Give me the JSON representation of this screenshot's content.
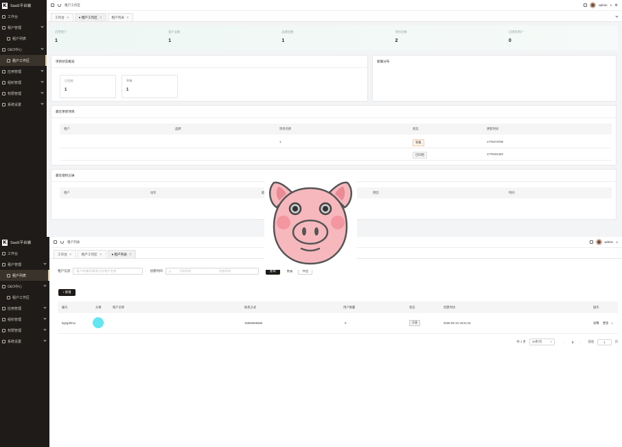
{
  "screen1": {
    "brand": "SaaS平台端",
    "nav": [
      {
        "label": "工作台",
        "icon": "desktop-icon"
      },
      {
        "label": "租户管理",
        "icon": "users-icon",
        "chevron": true
      },
      {
        "label": "租户列表",
        "icon": "user-icon",
        "sub": true
      },
      {
        "label": "GEO中心",
        "icon": "globe-icon",
        "chevron": true
      },
      {
        "label": "租户工作区",
        "icon": "monitor-icon",
        "sub": true,
        "active": true
      },
      {
        "label": "应用管理",
        "icon": "app-icon",
        "chevron": true
      },
      {
        "label": "组织管理",
        "icon": "org-icon",
        "chevron": true
      },
      {
        "label": "权限管理",
        "icon": "lock-icon",
        "chevron": true
      },
      {
        "label": "系统设置",
        "icon": "gear-icon",
        "chevron": true
      }
    ],
    "breadcrumb": "租户工作区",
    "user": "admin",
    "tabs": [
      {
        "label": "工作台",
        "active": false
      },
      {
        "label": "● 租户工作区",
        "active": true
      },
      {
        "label": "租户列表",
        "active": false
      }
    ],
    "stats": [
      {
        "label": "启用租户",
        "value": "1"
      },
      {
        "label": "客户总数",
        "value": "1"
      },
      {
        "label": "品牌总数",
        "value": "1"
      },
      {
        "label": "项目总数",
        "value": "2"
      },
      {
        "label": "已授权用户",
        "value": "0"
      }
    ],
    "project_status": {
      "title": "项目状态概览",
      "items": [
        {
          "label": "已归档",
          "value": "1"
        },
        {
          "label": "草稿",
          "value": "1"
        }
      ]
    },
    "ranking_title": "套餐分布",
    "recent": {
      "title": "最近更新项目",
      "columns": [
        "租户",
        "品牌",
        "项目名称",
        "状态",
        "更新时间"
      ],
      "rows": [
        {
          "name": "1",
          "status": "草稿",
          "time": "1779473706"
        },
        {
          "name": "",
          "status": "已归档",
          "time": "1779431402"
        }
      ]
    },
    "authz": {
      "title": "最近授权记录",
      "columns": [
        "租户",
        "动作",
        "能力值",
        "原因",
        "时间"
      ]
    }
  },
  "screen2": {
    "brand": "SaaS平台端",
    "nav": [
      {
        "label": "工作台",
        "icon": "desktop-icon"
      },
      {
        "label": "租户管理",
        "icon": "users-icon",
        "chevron": true
      },
      {
        "label": "租户列表",
        "icon": "user-icon",
        "sub": true,
        "active": true
      },
      {
        "label": "GEO中心",
        "icon": "globe-icon",
        "chevron": true
      },
      {
        "label": "租户工作区",
        "icon": "monitor-icon",
        "sub": true
      },
      {
        "label": "应用管理",
        "icon": "app-icon",
        "chevron": true
      },
      {
        "label": "组织管理",
        "icon": "org-icon",
        "chevron": true
      },
      {
        "label": "权限管理",
        "icon": "lock-icon",
        "chevron": true
      },
      {
        "label": "系统设置",
        "icon": "gear-icon",
        "chevron": true
      }
    ],
    "breadcrumb": "租户列表",
    "user": "admin",
    "tabs": [
      {
        "label": "工作台",
        "active": false
      },
      {
        "label": "租户工作区",
        "active": false
      },
      {
        "label": "● 租户列表",
        "active": true
      }
    ],
    "filter": {
      "tenant_label": "租户信息",
      "tenant_placeholder": "租户ID/编号/联系方式/租户名称",
      "created_label": "创建时间",
      "start_placeholder": "开始时间",
      "range_sep": "-",
      "end_placeholder": "结束时间",
      "search": "查询",
      "reset": "重置",
      "export": "导出"
    },
    "add_button": "+ 新增",
    "table": {
      "columns": [
        "编号",
        "头像",
        "租户名称",
        "联系方式",
        "用户数量",
        "状态",
        "创建时间",
        "操作"
      ],
      "rows": [
        {
          "id": "5gsgd0mu",
          "name": "",
          "contact": "16666666666",
          "users": "0",
          "status": "开通",
          "created": "2026-05-10 19:21:01",
          "detail": "详情",
          "more": "更多"
        }
      ]
    },
    "pagination": {
      "total": "共 1 条",
      "page_size": "10条/页",
      "current": "1",
      "goto_label": "前往",
      "goto_value": "1",
      "page_unit": "页"
    }
  },
  "colors": {
    "sidebar": "#1e1b18",
    "accent": "#e2c9a2",
    "avatar_circle": "#64e6f0"
  }
}
